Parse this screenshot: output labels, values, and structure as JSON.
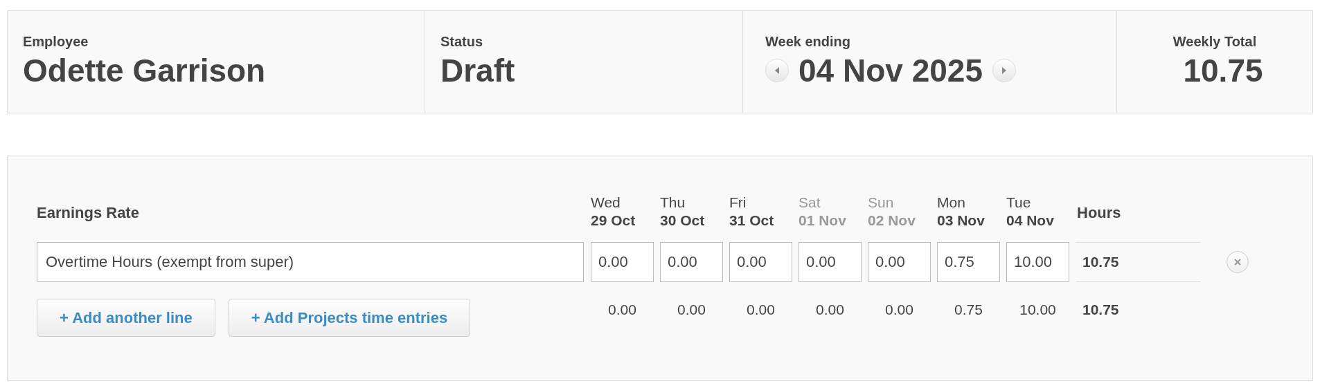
{
  "summary": [
    {
      "label": "Employee",
      "value": "Odette Garrison",
      "kind": "text"
    },
    {
      "label": "Status",
      "value": "Draft",
      "kind": "text"
    },
    {
      "label": "Week ending",
      "value": "04 Nov 2025",
      "kind": "week"
    },
    {
      "label": "Weekly Total",
      "value": "10.75",
      "kind": "total"
    }
  ],
  "timesheet": {
    "rate_heading": "Earnings Rate",
    "hours_heading": "Hours",
    "days": [
      {
        "day": "Wed",
        "date": "29 Oct",
        "weekend": false
      },
      {
        "day": "Thu",
        "date": "30 Oct",
        "weekend": false
      },
      {
        "day": "Fri",
        "date": "31 Oct",
        "weekend": false
      },
      {
        "day": "Sat",
        "date": "01 Nov",
        "weekend": true
      },
      {
        "day": "Sun",
        "date": "02 Nov",
        "weekend": true
      },
      {
        "day": "Mon",
        "date": "03 Nov",
        "weekend": false
      },
      {
        "day": "Tue",
        "date": "04 Nov",
        "weekend": false
      }
    ],
    "lines": [
      {
        "rate": "Overtime Hours (exempt from super)",
        "hours": [
          "0.00",
          "0.00",
          "0.00",
          "0.00",
          "0.00",
          "0.75",
          "10.00"
        ],
        "total": "10.75"
      }
    ],
    "buttons": [
      "+ Add another line",
      "+ Add Projects time entries"
    ],
    "totals": [
      "0.00",
      "0.00",
      "0.00",
      "0.00",
      "0.00",
      "0.75",
      "10.00"
    ],
    "grand_total": "10.75"
  }
}
